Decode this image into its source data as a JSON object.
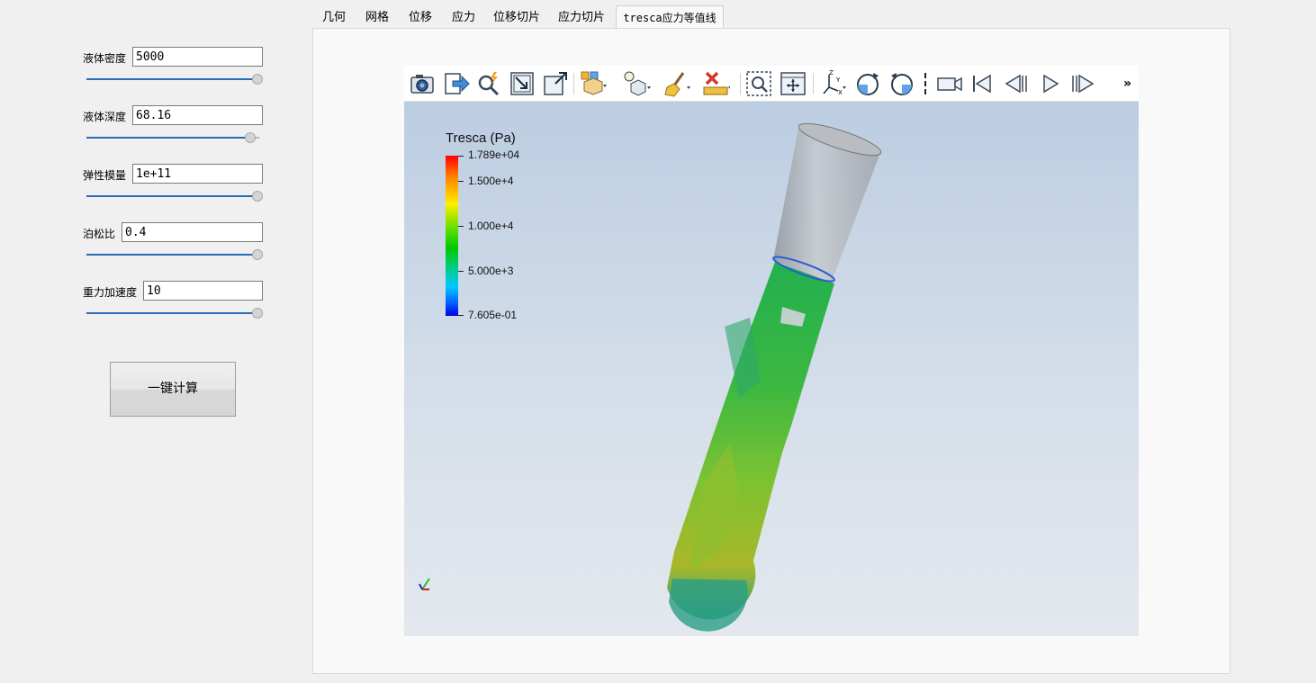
{
  "params": [
    {
      "label": "液体密度",
      "value": "5000",
      "slider": 1.0
    },
    {
      "label": "液体深度",
      "value": "68.16",
      "slider": 0.96
    },
    {
      "label": "弹性模量",
      "value": "1e+11",
      "slider": 1.0
    },
    {
      "label": "泊松比",
      "value": "0.4",
      "slider": 1.0
    },
    {
      "label": "重力加速度",
      "value": "10",
      "slider": 1.0
    }
  ],
  "calc_button": "一键计算",
  "tabs": [
    "几何",
    "网格",
    "位移",
    "应力",
    "位移切片",
    "应力切片",
    "tresca应力等值线"
  ],
  "active_tab": 6,
  "toolbar": {
    "icons": [
      "camera-icon",
      "export-icon",
      "find-data-icon",
      "reset-camera-icon",
      "zoom-to-data-icon",
      "split-view-icon",
      "light-icon",
      "clear-icon",
      "ruler-delete-icon",
      "zoom-to-box-icon",
      "interact-icon",
      "axes-orient-icon",
      "rotate-cw-icon",
      "rotate-ccw-icon",
      "camera-record-icon",
      "first-frame-icon",
      "prev-frame-icon",
      "play-icon",
      "last-frame-icon"
    ],
    "overflow": "»"
  },
  "legend": {
    "title": "Tresca (Pa)",
    "labels": [
      "1.789e+04",
      "1.500e+4",
      "1.000e+4",
      "5.000e+3",
      "7.605e-01"
    ],
    "values": [
      17890,
      15000,
      10000,
      5000,
      0.7605
    ]
  },
  "colors": {
    "slider": "#2a6db5",
    "background_top": "#bccde2",
    "background_bottom": "#e4e8ee"
  }
}
